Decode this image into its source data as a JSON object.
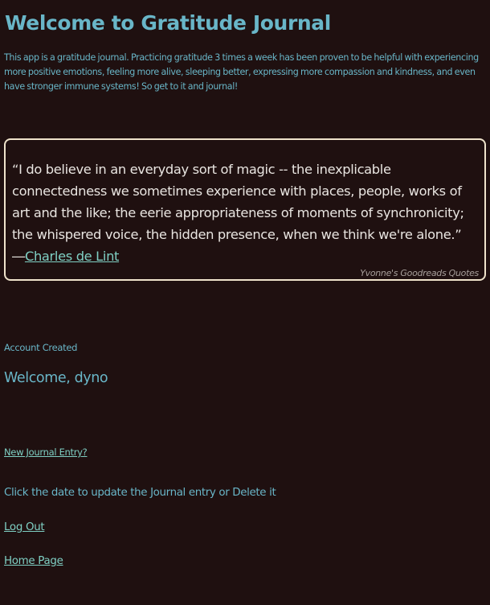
{
  "header": {
    "title": "Welcome to Gratitude Journal",
    "intro": "This app is a gratitude journal. Practicing gratitude 3 times a week has been proven to be helpful with experiencing more positive emotions, feeling more alive, sleeping better, expressing more compassion and kindness, and even have stronger immune systems! So get to it and journal!"
  },
  "quote": {
    "text": "“I do believe in an everyday sort of magic -- the inexplicable connectedness we sometimes experience with places, people, works of art and the like; the eerie appropriateness of moments of synchronicity; the whispered voice, the hidden presence, when we think we're alone.” ―",
    "author": "Charles de Lint",
    "source": "Yvonne's Goodreads Quotes"
  },
  "account": {
    "status": "Account Created",
    "welcome": "Welcome, dyno"
  },
  "links": {
    "new_entry": "New Journal Entry?",
    "instruction": "Click the date to update the Journal entry or Delete it",
    "logout": "Log Out",
    "home": "Home Page"
  },
  "colors": {
    "background": "#1f1010",
    "heading": "#69b6c8",
    "link": "#7fd0c4",
    "quote_text": "#e9e5e1",
    "quote_border": "#efe3cb"
  }
}
